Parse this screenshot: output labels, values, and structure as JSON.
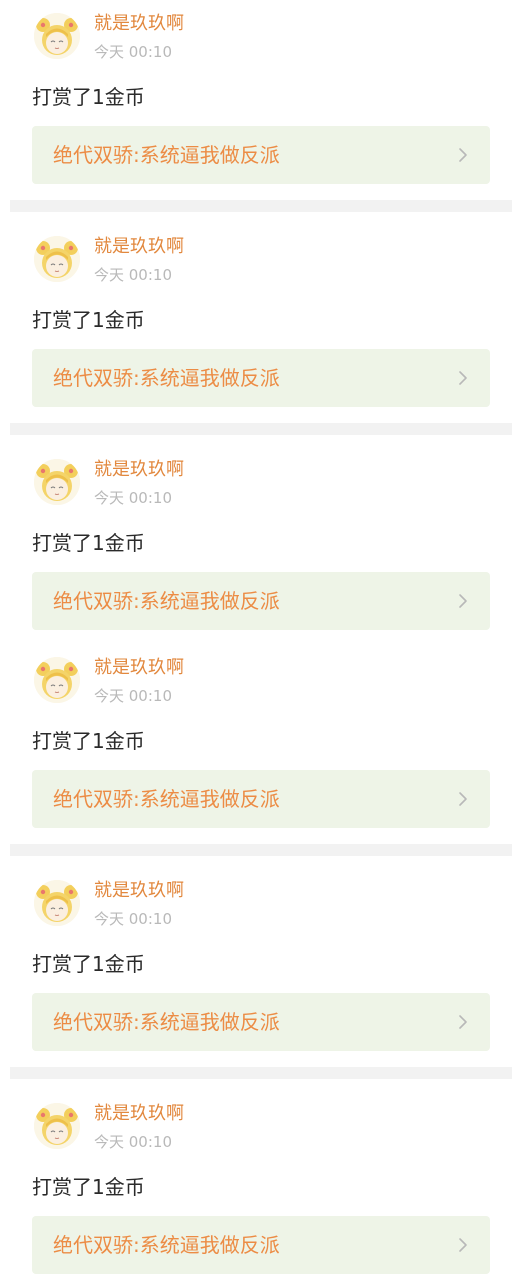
{
  "colors": {
    "username": "#e2883e",
    "timestamp": "#b9b9b9",
    "message": "#2a2a2a",
    "book_title": "#ec8c45",
    "book_card_bg": "#eef4e7",
    "separator": "#f2f2f2"
  },
  "icons": {
    "avatar": "cartoon-girl-avatar-icon",
    "arrow": "chevron-right-icon"
  },
  "feed": [
    {
      "username": "就是玖玖啊",
      "timestamp": "今天 00:10",
      "message": "打赏了1金币",
      "book_title": "绝代双骄:系统逼我做反派"
    },
    {
      "username": "就是玖玖啊",
      "timestamp": "今天 00:10",
      "message": "打赏了1金币",
      "book_title": "绝代双骄:系统逼我做反派"
    },
    {
      "username": "就是玖玖啊",
      "timestamp": "今天 00:10",
      "message": "打赏了1金币",
      "book_title": "绝代双骄:系统逼我做反派"
    },
    {
      "username": "就是玖玖啊",
      "timestamp": "今天 00:10",
      "message": "打赏了1金币",
      "book_title": "绝代双骄:系统逼我做反派"
    },
    {
      "username": "就是玖玖啊",
      "timestamp": "今天 00:10",
      "message": "打赏了1金币",
      "book_title": "绝代双骄:系统逼我做反派"
    },
    {
      "username": "就是玖玖啊",
      "timestamp": "今天 00:10",
      "message": "打赏了1金币",
      "book_title": "绝代双骄:系统逼我做反派"
    }
  ]
}
